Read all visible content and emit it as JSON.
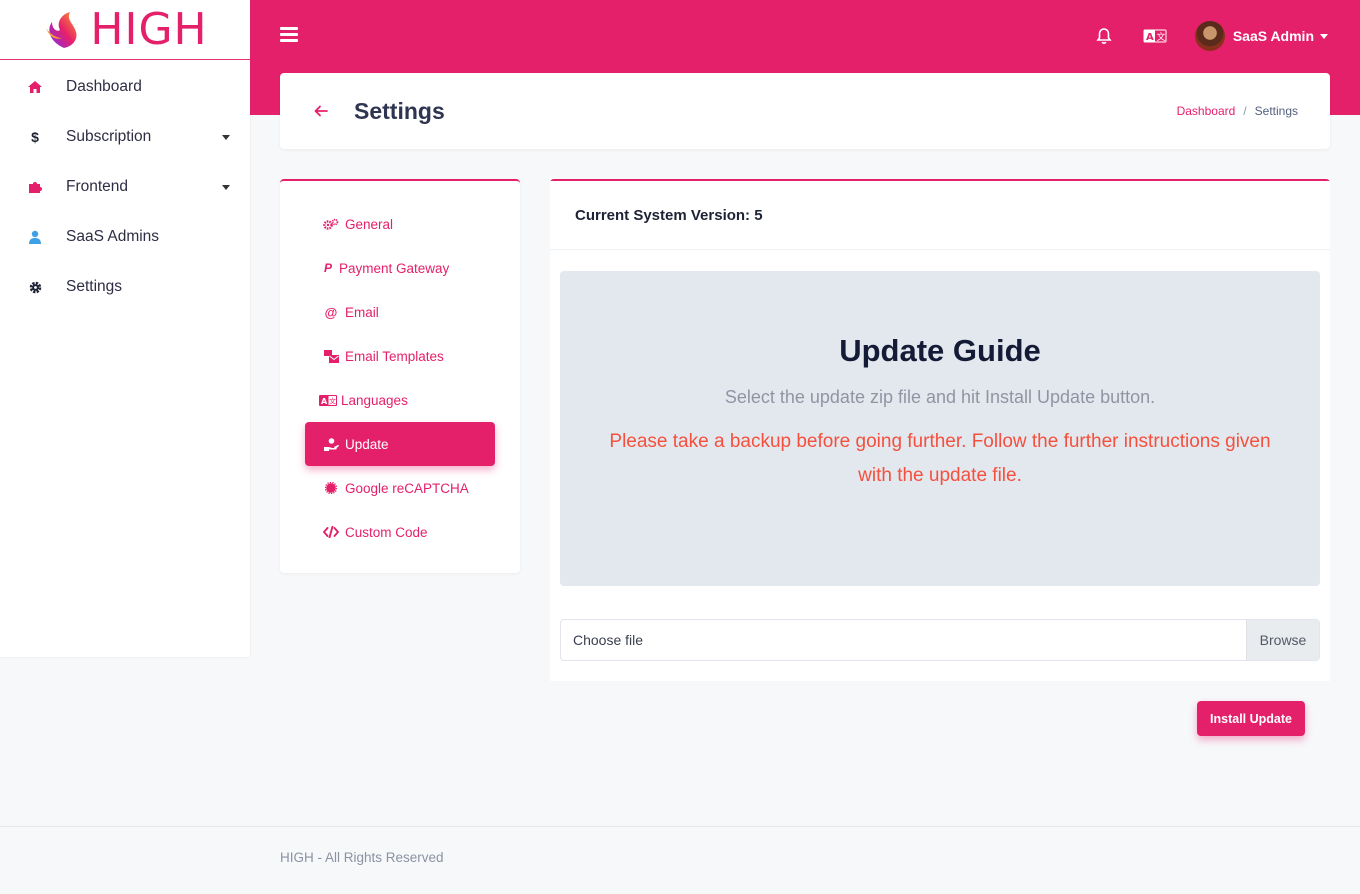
{
  "brand": {
    "name": "HIGH",
    "accent": "#e5206a"
  },
  "sidebar": {
    "items": [
      {
        "label": "Dashboard",
        "icon": "home-icon",
        "color": "#e5206a",
        "has_caret": false
      },
      {
        "label": "Subscription",
        "icon": "dollar-icon",
        "color": "#1e2235",
        "has_caret": true
      },
      {
        "label": "Frontend",
        "icon": "puzzle-icon",
        "color": "#e5206a",
        "has_caret": true
      },
      {
        "label": "SaaS Admins",
        "icon": "user-icon",
        "color": "#3ea0e6",
        "has_caret": false
      },
      {
        "label": "Settings",
        "icon": "gear-icon",
        "color": "#1e2235",
        "has_caret": false
      }
    ]
  },
  "topbar": {
    "user_name": "SaaS Admin",
    "icons": [
      "menu-icon",
      "bell-icon",
      "language-icon"
    ]
  },
  "page_header": {
    "title": "Settings",
    "breadcrumb": {
      "link": "Dashboard",
      "separator": "/",
      "current": "Settings"
    }
  },
  "settings_menu": {
    "items": [
      {
        "label": "General",
        "icon": "gears-icon"
      },
      {
        "label": "Payment Gateway",
        "icon": "paypal-icon"
      },
      {
        "label": "Email",
        "icon": "at-icon"
      },
      {
        "label": "Email Templates",
        "icon": "mail-bulk-icon"
      },
      {
        "label": "Languages",
        "icon": "language-icon"
      },
      {
        "label": "Update",
        "icon": "hand-holding-icon",
        "active": true
      },
      {
        "label": "Google reCAPTCHA",
        "icon": "certificate-icon"
      },
      {
        "label": "Custom Code",
        "icon": "code-icon"
      }
    ]
  },
  "main": {
    "version_label": "Current System Version: 5",
    "guide_title": "Update Guide",
    "guide_subtitle": "Select the update zip file and hit Install Update button.",
    "guide_warning": "Please take a backup before going further. Follow the further instructions given with the update file.",
    "file_placeholder": "Choose file",
    "browse_label": "Browse",
    "install_label": "Install Update"
  },
  "footer": {
    "text": "HIGH - All Rights Reserved"
  }
}
